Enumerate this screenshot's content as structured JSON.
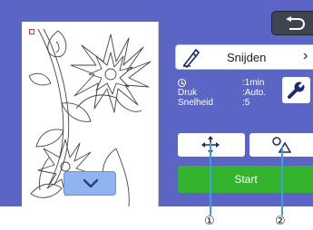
{
  "mode": {
    "label": "Snijden",
    "chevron": "›",
    "icon": "pen-icon"
  },
  "info": {
    "time_value": ":1min",
    "pressure_label": "Druk",
    "pressure_value": ":Auto.",
    "speed_label": "Snelheid",
    "speed_value": ":5"
  },
  "buttons": {
    "start_label": "Start",
    "back_icon": "return-icon",
    "settings_icon": "wrench-icon",
    "move_icon": "move-arrows-icon",
    "edit_icon": "edit-shapes-icon",
    "scroll_icon": "chevron-down-icon"
  },
  "callouts": [
    "①",
    "②"
  ],
  "colors": {
    "screen_bg": "#5b66c4",
    "start_green": "#35b32f",
    "callout_blue": "#3e9fe0",
    "dark_button": "#3e4450"
  }
}
